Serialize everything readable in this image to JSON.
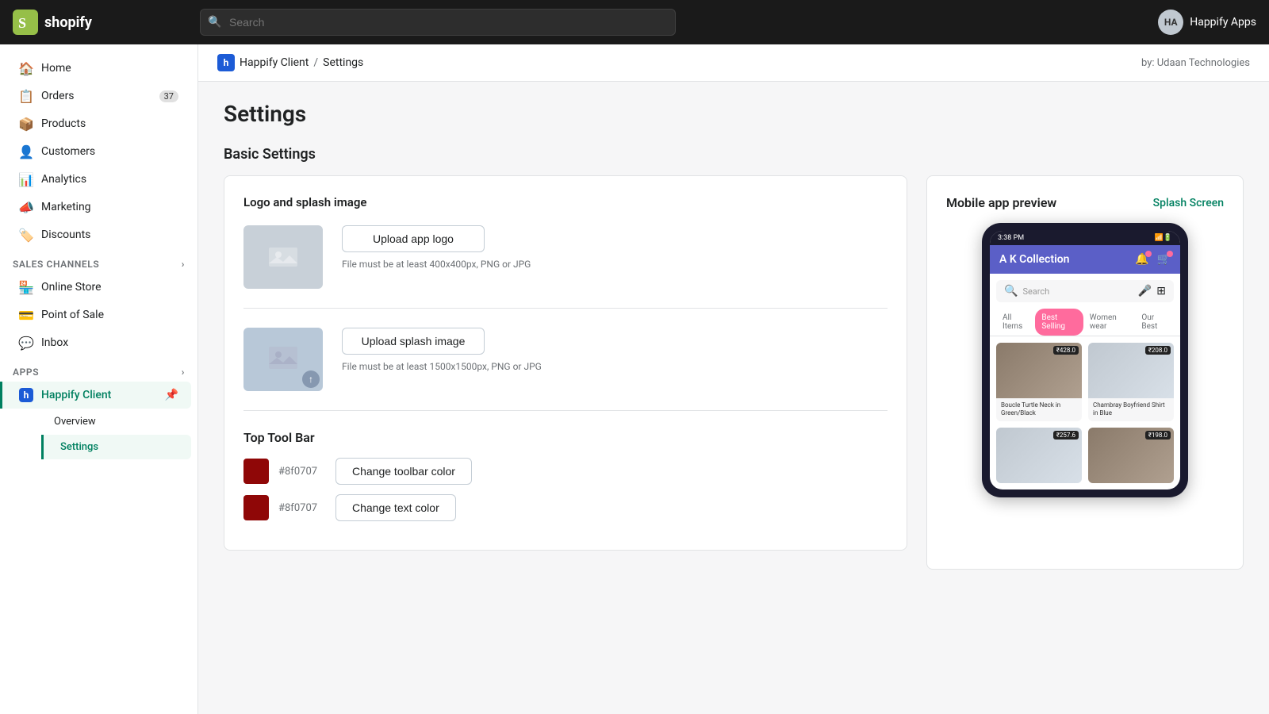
{
  "topnav": {
    "logo_text": "shopify",
    "search_placeholder": "Search",
    "user_initials": "HA",
    "user_name": "Happify Apps"
  },
  "sidebar": {
    "items": [
      {
        "id": "home",
        "label": "Home",
        "icon": "🏠"
      },
      {
        "id": "orders",
        "label": "Orders",
        "icon": "📋",
        "badge": "37"
      },
      {
        "id": "products",
        "label": "Products",
        "icon": "📦"
      },
      {
        "id": "customers",
        "label": "Customers",
        "icon": "👤"
      },
      {
        "id": "analytics",
        "label": "Analytics",
        "icon": "📊"
      },
      {
        "id": "marketing",
        "label": "Marketing",
        "icon": "📣"
      },
      {
        "id": "discounts",
        "label": "Discounts",
        "icon": "🏷️"
      }
    ],
    "sales_channels_label": "Sales channels",
    "sales_channels": [
      {
        "id": "online-store",
        "label": "Online Store",
        "icon": "🏪"
      },
      {
        "id": "point-of-sale",
        "label": "Point of Sale",
        "icon": "💳"
      },
      {
        "id": "inbox",
        "label": "Inbox",
        "icon": "💬"
      }
    ],
    "apps_label": "Apps",
    "apps": [
      {
        "id": "happify-client",
        "label": "Happify Client",
        "icon": "h",
        "active": true
      }
    ],
    "sub_items": [
      {
        "id": "overview",
        "label": "Overview"
      },
      {
        "id": "settings",
        "label": "Settings",
        "active": true
      }
    ]
  },
  "breadcrumb": {
    "app_icon": "h",
    "app_name": "Happify Client",
    "separator": "/",
    "current": "Settings",
    "by_text": "by: Udaan Technologies"
  },
  "page": {
    "title": "Settings",
    "section_title": "Basic Settings"
  },
  "logo_splash": {
    "card_title": "Logo and splash image",
    "upload_logo_label": "Upload app logo",
    "upload_logo_hint": "File must be at least 400x400px, PNG or JPG",
    "upload_splash_label": "Upload splash image",
    "upload_splash_hint": "File must be at least 1500x1500px, PNG or JPG",
    "toolbar_title": "Top Tool Bar",
    "toolbar_color_value": "#8f0707",
    "toolbar_color_btn": "Change toolbar color",
    "text_color_value": "#8f0707",
    "text_color_btn": "Change text color"
  },
  "preview": {
    "title": "Mobile app preview",
    "splash_link": "Splash Screen",
    "phone": {
      "status": "3:38 PM",
      "app_title": "A K Collection",
      "search_placeholder": "Search",
      "tabs": [
        "All Items",
        "Best Selling",
        "Women wear",
        "Our Best"
      ],
      "active_tab": "Best Selling",
      "products": [
        {
          "name": "Boucle Turtle Neck in Green/Black",
          "price": "₹428.0",
          "style": "dark"
        },
        {
          "name": "Chambray Boyfriend Shirt in Blue",
          "price": "₹208.0",
          "style": "light"
        },
        {
          "name": "",
          "price": "₹257.6",
          "style": "light"
        },
        {
          "name": "",
          "price": "₹198.0",
          "style": "dark"
        }
      ]
    }
  }
}
